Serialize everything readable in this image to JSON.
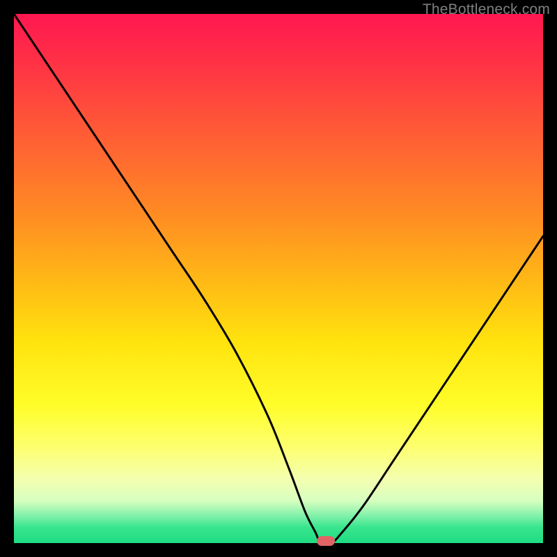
{
  "watermark": "TheBottleneck.com",
  "chart_data": {
    "type": "line",
    "title": "",
    "xlabel": "",
    "ylabel": "",
    "xlim": [
      0,
      100
    ],
    "ylim": [
      0,
      100
    ],
    "grid": false,
    "legend": false,
    "series": [
      {
        "name": "bottleneck-curve",
        "x": [
          0,
          6,
          12,
          18,
          24,
          30,
          36,
          42,
          48,
          52,
          55,
          57,
          58,
          60,
          62,
          66,
          72,
          80,
          90,
          100
        ],
        "values": [
          100,
          91,
          82,
          73,
          64,
          55,
          46,
          36,
          24,
          14,
          6,
          2,
          0,
          0,
          2,
          7,
          16,
          28,
          43,
          58
        ]
      }
    ],
    "marker": {
      "x": 59,
      "y": 0
    },
    "colors": {
      "top": "#ff1750",
      "mid": "#ffe30e",
      "bottom": "#1edc82",
      "marker": "#e06464",
      "curve": "#000000"
    }
  }
}
